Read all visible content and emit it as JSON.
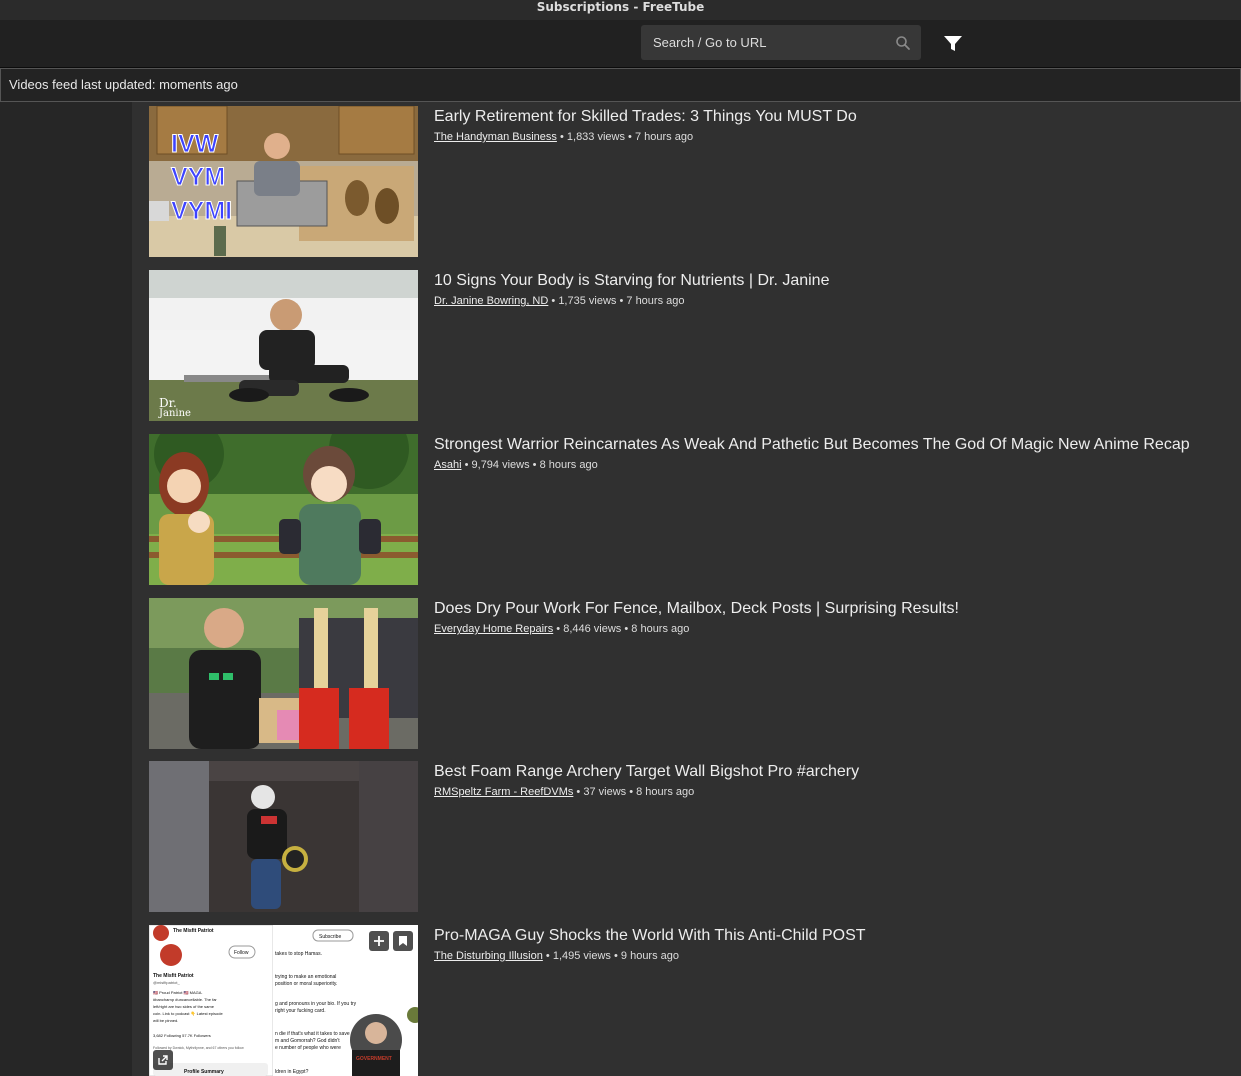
{
  "window": {
    "title": "Subscriptions - FreeTube"
  },
  "search": {
    "placeholder": "Search / Go to URL"
  },
  "feed_status": "Videos feed last updated: moments ago",
  "videos": [
    {
      "title": "Early Retirement for Skilled Trades: 3 Things You MUST Do",
      "channel": "The Handyman Business",
      "views": "1,833 views",
      "age": "7 hours ago"
    },
    {
      "title": "10 Signs Your Body is Starving for Nutrients | Dr. Janine",
      "channel": "Dr. Janine Bowring, ND",
      "views": "1,735 views",
      "age": "7 hours ago"
    },
    {
      "title": "Strongest Warrior Reincarnates As Weak And Pathetic But Becomes The God Of Magic New Anime Recap",
      "channel": "Asahi",
      "views": "9,794 views",
      "age": "8 hours ago"
    },
    {
      "title": "Does Dry Pour Work For Fence, Mailbox, Deck Posts | Surprising Results!",
      "channel": "Everyday Home Repairs",
      "views": "8,446 views",
      "age": "8 hours ago"
    },
    {
      "title": "Best Foam Range Archery Target Wall Bigshot Pro #archery",
      "channel": "RMSpeltz Farm - ReefDVMs",
      "views": "37 views",
      "age": "8 hours ago"
    },
    {
      "title": "Pro-MAGA Guy Shocks the World With This Anti-Child POST",
      "channel": "The Disturbing Illusion",
      "views": "1,495 views",
      "age": "9 hours ago"
    }
  ],
  "thumb_text": {
    "t1": [
      "IVW",
      "VYM",
      "VYMI"
    ],
    "t2": [
      "Dr.",
      "Janine"
    ],
    "t6": {
      "name": "The Misfit Patriot",
      "follow": "Follow",
      "subscribe": "Subscribe",
      "left_lines": [
        "The Misfit Patriot",
        "@misfitpatriot_",
        "🇺🇸 Proud Patriot 🇺🇸 MAGA.",
        "#bancharnp #uncancellable. The far",
        "left/right are two sides of the same",
        "coin. Link to podcast 👇 Latest episode",
        "will be pinned."
      ],
      "stats": "3,682 Following  57.7K Followers",
      "followed_by": "Followed by Dwnick, Mythrilynne, and 67 others you follow",
      "profile_summary": "Profile Summary",
      "right_lines": [
        "takes to stop Hamas.",
        "trying to make an emotional",
        "position or moral superiority.",
        "g and pronouns in your bio. If you try",
        "right your fucking card.",
        "n die if that's what it takes to save",
        "m and Gomorrah? God didn't",
        "e number of people who were",
        "ldren in Egypt?"
      ],
      "badge": "GOVERNMENT"
    }
  },
  "colors": {
    "accent": "#ffffff",
    "feed_bg": "#303030",
    "sidebar_bg": "#262626",
    "nav_bg": "#212121"
  },
  "icons": {
    "search": "search-icon",
    "filter": "filter-icon",
    "add": "plus-icon",
    "save": "bookmark-icon",
    "external": "external-link-icon"
  }
}
